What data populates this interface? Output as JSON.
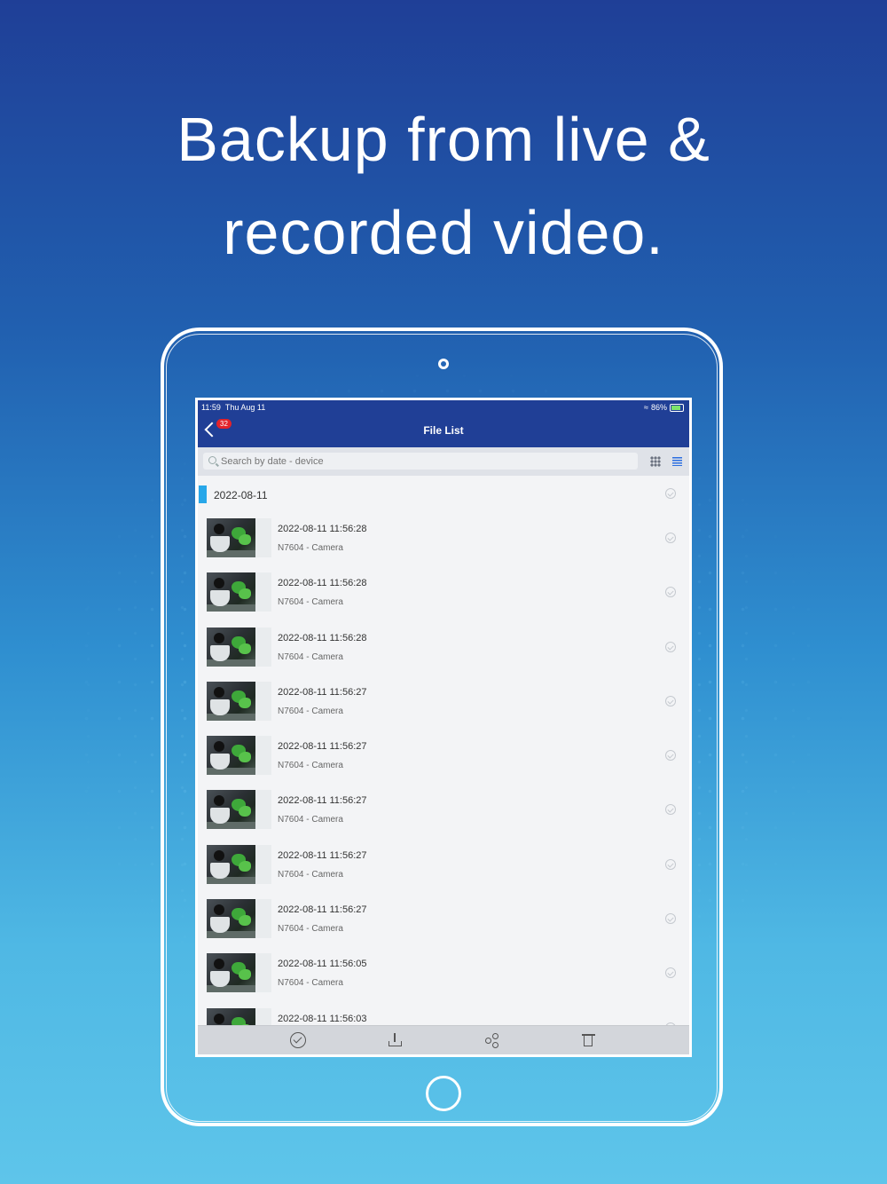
{
  "headline": {
    "line1": "Backup from live &",
    "line2": "recorded video."
  },
  "status_bar": {
    "time": "11:59",
    "date": "Thu Aug 11",
    "battery": "86%"
  },
  "nav": {
    "title": "File List",
    "badge": "32"
  },
  "search": {
    "placeholder": "Search by date - device"
  },
  "section": {
    "date": "2022-08-11"
  },
  "files": [
    {
      "time": "2022-08-11 11:56:28",
      "device": "N7604 - Camera"
    },
    {
      "time": "2022-08-11 11:56:28",
      "device": "N7604 - Camera"
    },
    {
      "time": "2022-08-11 11:56:28",
      "device": "N7604 - Camera"
    },
    {
      "time": "2022-08-11 11:56:27",
      "device": "N7604 - Camera"
    },
    {
      "time": "2022-08-11 11:56:27",
      "device": "N7604 - Camera"
    },
    {
      "time": "2022-08-11 11:56:27",
      "device": "N7604 - Camera"
    },
    {
      "time": "2022-08-11 11:56:27",
      "device": "N7604 - Camera"
    },
    {
      "time": "2022-08-11 11:56:27",
      "device": "N7604 - Camera"
    },
    {
      "time": "2022-08-11 11:56:05",
      "device": "N7604 - Camera"
    },
    {
      "time": "2022-08-11 11:56:03",
      "device": ""
    }
  ],
  "toolbar": [
    "select-icon",
    "download-icon",
    "share-icon",
    "trash-icon"
  ],
  "colors": {
    "nav": "#203f96",
    "accent": "#27a7e9",
    "badge": "#e3222a"
  }
}
